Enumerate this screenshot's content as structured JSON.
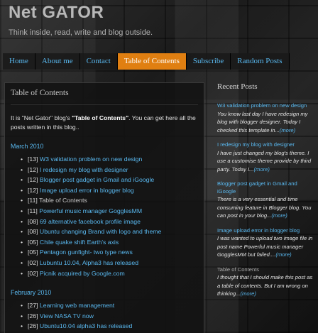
{
  "header": {
    "site_title": "Net GATOR",
    "tagline": "Think inside, read, write and blog outside."
  },
  "nav": {
    "items": [
      {
        "label": "Home",
        "active": false
      },
      {
        "label": "About me",
        "active": false
      },
      {
        "label": "Contact",
        "active": false
      },
      {
        "label": "Table of Contents",
        "active": true
      },
      {
        "label": "Subscribe",
        "active": false
      },
      {
        "label": "Random Posts",
        "active": false
      }
    ]
  },
  "post": {
    "title": "Table of Contents",
    "intro_a": "It is \"Net Gator\" blog's ",
    "intro_bold": "\"Table of Contents\"",
    "intro_b": ". You can get here all the posts written in this blog.."
  },
  "toc": {
    "months": [
      {
        "label": "March 2010",
        "items": [
          {
            "num": "[13]",
            "title": "W3 validation problem on new design",
            "link": true
          },
          {
            "num": "[12]",
            "title": "I redesign my blog with designer",
            "link": true
          },
          {
            "num": "[12]",
            "title": "Blogger post gadget in Gmail and iGoogle",
            "link": true
          },
          {
            "num": "[12]",
            "title": "Image upload error in blogger blog",
            "link": true
          },
          {
            "num": "[11]",
            "title": "Table of Contents",
            "link": false
          },
          {
            "num": "[11]",
            "title": "Powerful music manager GogglesMM",
            "link": true
          },
          {
            "num": "[08]",
            "title": "69 alternative facebook profile image",
            "link": true
          },
          {
            "num": "[08]",
            "title": "Ubuntu changing Brand with logo and theme",
            "link": true
          },
          {
            "num": "[05]",
            "title": "Chile quake shift Earth's axis",
            "link": true
          },
          {
            "num": "[05]",
            "title": "Pentagon gunfight- two type news",
            "link": true
          },
          {
            "num": "[02]",
            "title": "Lubuntu 10.04, Alpha3 has released",
            "link": true
          },
          {
            "num": "[02]",
            "title": "Picnik acquired by Google.com",
            "link": true
          }
        ]
      },
      {
        "label": "February 2010",
        "items": [
          {
            "num": "[27]",
            "title": "Learning web management",
            "link": true
          },
          {
            "num": "[26]",
            "title": "View NASA TV now",
            "link": true
          },
          {
            "num": "[26]",
            "title": "Ubuntu10.04 alpha3 has released",
            "link": true
          }
        ]
      }
    ]
  },
  "sidebar": {
    "title": "Recent Posts",
    "posts": [
      {
        "title": "W3 validation problem on new design",
        "excerpt": "You know last day I have redesign my blog with blogger designer. Today I checked this template in...",
        "more": "(more)",
        "title_color": "blue"
      },
      {
        "title": "I redesign my blog with designer",
        "excerpt": "I have just changed my blog's theme. I use a customise theme provide by third party. Today I...",
        "more": "(more)",
        "title_color": "blue"
      },
      {
        "title": "Blogger post gadget in Gmail and iGoogle",
        "excerpt": "There is a very essential and time consuming feature in Blogger blog. You can post in your blog...",
        "more": "(more)",
        "title_color": "blue"
      },
      {
        "title": "Image upload error in blogger blog",
        "excerpt": "I was wanted to upload two image file in post name Powerful music manager GogglesMM but failed....",
        "more": "(more)",
        "title_color": "blue"
      },
      {
        "title": "Table of Contents",
        "excerpt": "I thought that I should make this post as a table of contents. But I am wrong on thinking...",
        "more": "(more)",
        "title_color": "gray"
      }
    ]
  }
}
